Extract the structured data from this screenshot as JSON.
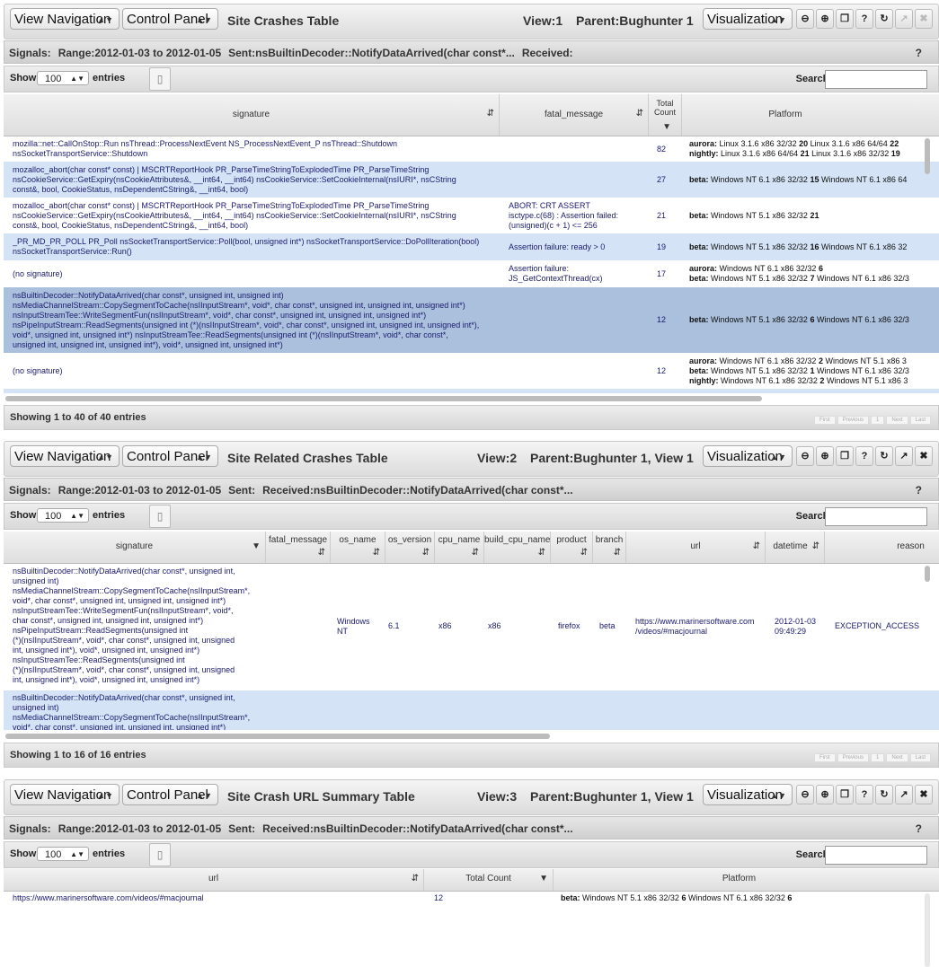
{
  "panels": [
    {
      "nav_label": "View Navigation",
      "control_label": "Control Panel",
      "title": "Site Crashes Table",
      "view": "View:1",
      "parent": "Parent:Bughunter 1",
      "viz_label": "Visualization",
      "signals": {
        "prefix": "Signals:",
        "range": "Range:2012-01-03 to 2012-01-05",
        "sent": "Sent:nsBuiltinDecoder::NotifyDataArrived(char const*...",
        "received": "Received:"
      },
      "show": "Show",
      "entries_label": "entries",
      "length": "100",
      "search_label": "Search:",
      "headers": [
        "signature",
        "fatal_message",
        "Total Count",
        "Platform"
      ],
      "rows": [
        {
          "signature": "mozilla::net::CallOnStop::Run nsThread::ProcessNextEvent NS_ProcessNextEvent_P nsThread::Shutdown\nnsSocketTransportService::Shutdown",
          "fatal": "",
          "count": "82",
          "platform": [
            [
              "aurora:",
              "Linux 3.1.6 x86 32/32",
              "20",
              "Linux 3.1.6 x86 64/64",
              "22"
            ],
            [
              "nightly:",
              "Linux 3.1.6 x86 64/64",
              "21",
              "Linux 3.1.6 x86 32/32",
              "19"
            ]
          ]
        },
        {
          "signature": "mozalloc_abort(char const* const) | MSCRTReportHook PR_ParseTimeStringToExplodedTime PR_ParseTimeString\nnsCookieService::GetExpiry(nsCookieAttributes&, __int64, __int64) nsCookieService::SetCookieInternal(nsIURI*, nsCString\nconst&, bool, CookieStatus, nsDependentCString&, __int64, bool)",
          "fatal": "",
          "count": "27",
          "platform": [
            [
              "beta:",
              "Windows NT 6.1 x86 32/32",
              "15",
              "Windows NT 6.1 x86 64",
              ""
            ]
          ]
        },
        {
          "signature": "mozalloc_abort(char const* const) | MSCRTReportHook PR_ParseTimeStringToExplodedTime PR_ParseTimeString\nnsCookieService::GetExpiry(nsCookieAttributes&, __int64, __int64) nsCookieService::SetCookieInternal(nsIURI*, nsCString\nconst&, bool, CookieStatus, nsDependentCString&, __int64, bool)",
          "fatal": "ABORT: CRT ASSERT\nisctype.c(68) : Assertion failed:\n(unsigned)(c + 1) <= 256",
          "count": "21",
          "platform": [
            [
              "beta:",
              "Windows NT 5.1 x86 32/32",
              "21",
              "",
              ""
            ]
          ]
        },
        {
          "signature": "_PR_MD_PR_POLL PR_Poll nsSocketTransportService::Poll(bool, unsigned int*) nsSocketTransportService::DoPollIteration(bool)\nnsSocketTransportService::Run()",
          "fatal": "Assertion failure: ready > 0",
          "count": "19",
          "platform": [
            [
              "beta:",
              "Windows NT 5.1 x86 32/32",
              "16",
              "Windows NT 6.1 x86 32",
              ""
            ]
          ]
        },
        {
          "signature": "(no signature)",
          "fatal": "Assertion failure:\nJS_GetContextThread(cx)",
          "count": "17",
          "platform": [
            [
              "aurora:",
              "Windows NT 6.1 x86 32/32",
              "6",
              "",
              ""
            ],
            [
              "beta:",
              "Windows NT 5.1 x86 32/32",
              "7",
              "Windows NT 6.1 x86 32/3",
              ""
            ]
          ]
        },
        {
          "signature": "nsBuiltinDecoder::NotifyDataArrived(char const*, unsigned int, unsigned int)\nnsMediaChannelStream::CopySegmentToCache(nsIInputStream*, void*, char const*, unsigned int, unsigned int, unsigned int*)\nnsInputStreamTee::WriteSegmentFun(nsIInputStream*, void*, char const*, unsigned int, unsigned int, unsigned int*)\nnsPipeInputStream::ReadSegments(unsigned int (*)(nsIInputStream*, void*, char const*, unsigned int, unsigned int, unsigned int*),\nvoid*, unsigned int, unsigned int*) nsInputStreamTee::ReadSegments(unsigned int (*)(nsIInputStream*, void*, char const*,\nunsigned int, unsigned int, unsigned int*), void*, unsigned int, unsigned int*)",
          "fatal": "",
          "count": "12",
          "platform": [
            [
              "beta:",
              "Windows NT 5.1 x86 32/32",
              "6",
              "Windows NT 6.1 x86 32/3",
              ""
            ]
          ]
        },
        {
          "signature": "(no signature)",
          "fatal": "",
          "count": "12",
          "platform": [
            [
              "aurora:",
              "Windows NT 6.1 x86 32/32",
              "2",
              "Windows NT 5.1 x86 3",
              ""
            ],
            [
              "beta:",
              "Windows NT 5.1 x86 32/32",
              "1",
              "Windows NT 6.1 x86 32/3",
              ""
            ],
            [
              "nightly:",
              "Windows NT 6.1 x86 32/32",
              "2",
              "Windows NT 5.1 x86 3",
              ""
            ]
          ]
        }
      ],
      "footer": "Showing 1 to 40 of 40 entries",
      "pager": [
        "First",
        "Previous",
        "1",
        "Next",
        "Last"
      ]
    },
    {
      "nav_label": "View Navigation",
      "control_label": "Control Panel",
      "title": "Site Related Crashes Table",
      "view": "View:2",
      "parent": "Parent:Bughunter 1, View 1",
      "viz_label": "Visualization",
      "signals": {
        "prefix": "Signals:",
        "range": "Range:2012-01-03 to 2012-01-05",
        "sent": "Sent:",
        "received": "Received:nsBuiltinDecoder::NotifyDataArrived(char const*..."
      },
      "show": "Show",
      "entries_label": "entries",
      "length": "100",
      "search_label": "Search:",
      "headers": [
        "signature",
        "fatal_message",
        "os_name",
        "os_version",
        "cpu_name",
        "build_cpu_name",
        "product",
        "branch",
        "url",
        "datetime",
        "reason"
      ],
      "rows": [
        {
          "signature": "nsBuiltinDecoder::NotifyDataArrived(char const*, unsigned int,\nunsigned int)\nnsMediaChannelStream::CopySegmentToCache(nsIInputStream*,\nvoid*, char const*, unsigned int, unsigned int, unsigned int*)\nnsInputStreamTee::WriteSegmentFun(nsIInputStream*, void*,\nchar const*, unsigned int, unsigned int, unsigned int*)\nnsPipeInputStream::ReadSegments(unsigned int\n(*)(nsIInputStream*, void*, char const*, unsigned int, unsigned\nint, unsigned int*), void*, unsigned int, unsigned int*)\nnsInputStreamTee::ReadSegments(unsigned int\n(*)(nsIInputStream*, void*, char const*, unsigned int, unsigned\nint, unsigned int*), void*, unsigned int, unsigned int*)",
          "os_name": "Windows\nNT",
          "os_version": "6.1",
          "cpu_name": "x86",
          "build_cpu_name": "x86",
          "product": "firefox",
          "branch": "beta",
          "url": "https://www.marinersoftware.com\n/videos/#macjournal",
          "datetime": "2012-01-03\n09:49:29",
          "reason": "EXCEPTION_ACCESS"
        },
        {
          "signature": "nsBuiltinDecoder::NotifyDataArrived(char const*, unsigned int,\nunsigned int)\nnsMediaChannelStream::CopySegmentToCache(nsIInputStream*,\nvoid*, char const*, unsigned int, unsigned int, unsigned int*)"
        }
      ],
      "footer": "Showing 1 to 16 of 16 entries",
      "pager": [
        "First",
        "Previous",
        "1",
        "Next",
        "Last"
      ]
    },
    {
      "nav_label": "View Navigation",
      "control_label": "Control Panel",
      "title": "Site Crash URL Summary Table",
      "view": "View:3",
      "parent": "Parent:Bughunter 1, View 1",
      "viz_label": "Visualization",
      "signals": {
        "prefix": "Signals:",
        "range": "Range:2012-01-03 to 2012-01-05",
        "sent": "Sent:",
        "received": "Received:nsBuiltinDecoder::NotifyDataArrived(char const*..."
      },
      "show": "Show",
      "entries_label": "entries",
      "length": "100",
      "search_label": "Search:",
      "headers": [
        "url",
        "Total Count",
        "Platform"
      ],
      "rows": [
        {
          "url": "https://www.marinersoftware.com/videos/#macjournal",
          "count": "12",
          "platform": [
            [
              "beta:",
              "Windows NT 5.1 x86 32/32",
              "6",
              "Windows NT 6.1 x86 32/32",
              "6"
            ]
          ]
        }
      ]
    }
  ],
  "icons": {
    "minimize": "minus-circle-icon",
    "add": "plus-circle-icon",
    "restore": "window-restore-icon",
    "help": "question-icon",
    "refresh": "refresh-icon",
    "popout": "external-link-icon",
    "close": "close-icon",
    "column_toggle": "columns-icon"
  },
  "colors": {
    "row_alt": "#d4e4f6",
    "row_selected": "#aac0dd",
    "link_text": "#1a1a6e"
  }
}
